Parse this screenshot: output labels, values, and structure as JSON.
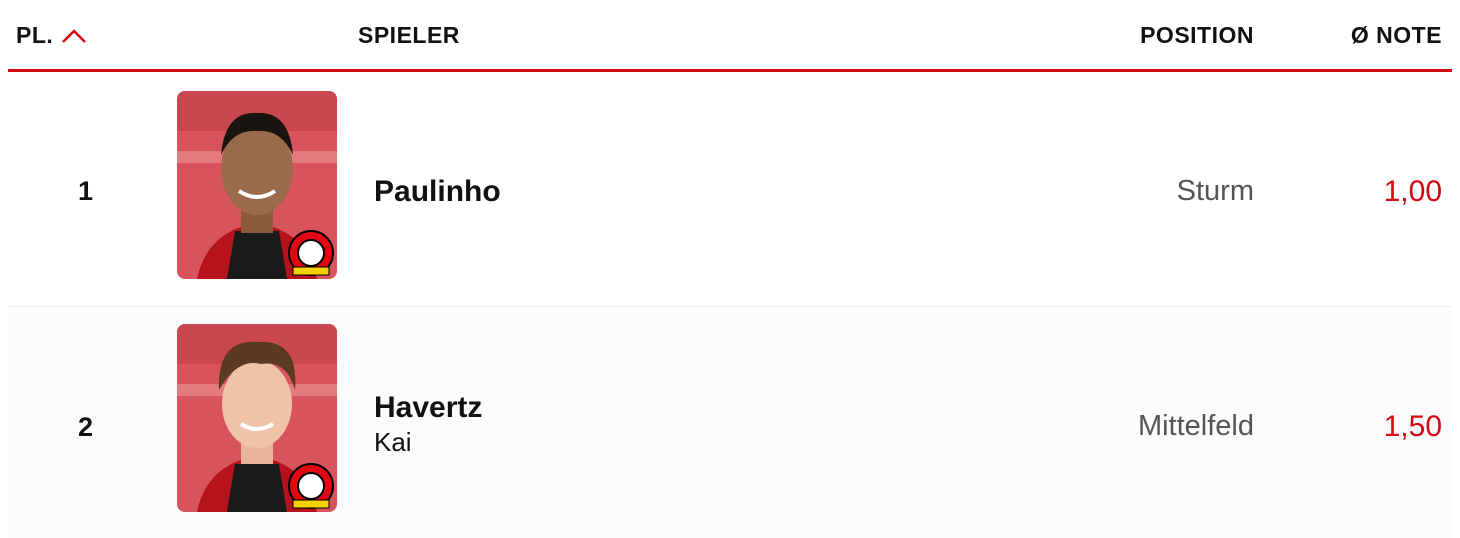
{
  "header": {
    "rank_label": "PL.",
    "player_label": "SPIELER",
    "position_label": "POSITION",
    "grade_label": "Ø NOTE",
    "sort_icon": "chevron-up-icon",
    "accent_color": "#d20a11"
  },
  "rows": [
    {
      "rank": "1",
      "last_name": "Paulinho",
      "first_name": "",
      "position": "Sturm",
      "grade": "1,00",
      "photo_icon": "player-photo",
      "badge_icon": "club-crest-icon"
    },
    {
      "rank": "2",
      "last_name": "Havertz",
      "first_name": "Kai",
      "position": "Mittelfeld",
      "grade": "1,50",
      "photo_icon": "player-photo",
      "badge_icon": "club-crest-icon"
    }
  ]
}
